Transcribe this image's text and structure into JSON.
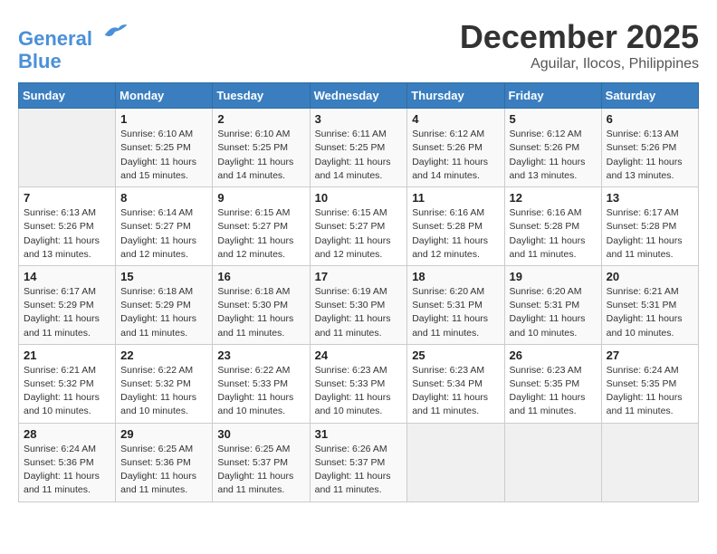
{
  "header": {
    "logo_line1": "General",
    "logo_line2": "Blue",
    "month": "December 2025",
    "location": "Aguilar, Ilocos, Philippines"
  },
  "days_of_week": [
    "Sunday",
    "Monday",
    "Tuesday",
    "Wednesday",
    "Thursday",
    "Friday",
    "Saturday"
  ],
  "weeks": [
    [
      {
        "day": "",
        "info": ""
      },
      {
        "day": "1",
        "info": "Sunrise: 6:10 AM\nSunset: 5:25 PM\nDaylight: 11 hours\nand 15 minutes."
      },
      {
        "day": "2",
        "info": "Sunrise: 6:10 AM\nSunset: 5:25 PM\nDaylight: 11 hours\nand 14 minutes."
      },
      {
        "day": "3",
        "info": "Sunrise: 6:11 AM\nSunset: 5:25 PM\nDaylight: 11 hours\nand 14 minutes."
      },
      {
        "day": "4",
        "info": "Sunrise: 6:12 AM\nSunset: 5:26 PM\nDaylight: 11 hours\nand 14 minutes."
      },
      {
        "day": "5",
        "info": "Sunrise: 6:12 AM\nSunset: 5:26 PM\nDaylight: 11 hours\nand 13 minutes."
      },
      {
        "day": "6",
        "info": "Sunrise: 6:13 AM\nSunset: 5:26 PM\nDaylight: 11 hours\nand 13 minutes."
      }
    ],
    [
      {
        "day": "7",
        "info": "Sunrise: 6:13 AM\nSunset: 5:26 PM\nDaylight: 11 hours\nand 13 minutes."
      },
      {
        "day": "8",
        "info": "Sunrise: 6:14 AM\nSunset: 5:27 PM\nDaylight: 11 hours\nand 12 minutes."
      },
      {
        "day": "9",
        "info": "Sunrise: 6:15 AM\nSunset: 5:27 PM\nDaylight: 11 hours\nand 12 minutes."
      },
      {
        "day": "10",
        "info": "Sunrise: 6:15 AM\nSunset: 5:27 PM\nDaylight: 11 hours\nand 12 minutes."
      },
      {
        "day": "11",
        "info": "Sunrise: 6:16 AM\nSunset: 5:28 PM\nDaylight: 11 hours\nand 12 minutes."
      },
      {
        "day": "12",
        "info": "Sunrise: 6:16 AM\nSunset: 5:28 PM\nDaylight: 11 hours\nand 11 minutes."
      },
      {
        "day": "13",
        "info": "Sunrise: 6:17 AM\nSunset: 5:28 PM\nDaylight: 11 hours\nand 11 minutes."
      }
    ],
    [
      {
        "day": "14",
        "info": "Sunrise: 6:17 AM\nSunset: 5:29 PM\nDaylight: 11 hours\nand 11 minutes."
      },
      {
        "day": "15",
        "info": "Sunrise: 6:18 AM\nSunset: 5:29 PM\nDaylight: 11 hours\nand 11 minutes."
      },
      {
        "day": "16",
        "info": "Sunrise: 6:18 AM\nSunset: 5:30 PM\nDaylight: 11 hours\nand 11 minutes."
      },
      {
        "day": "17",
        "info": "Sunrise: 6:19 AM\nSunset: 5:30 PM\nDaylight: 11 hours\nand 11 minutes."
      },
      {
        "day": "18",
        "info": "Sunrise: 6:20 AM\nSunset: 5:31 PM\nDaylight: 11 hours\nand 11 minutes."
      },
      {
        "day": "19",
        "info": "Sunrise: 6:20 AM\nSunset: 5:31 PM\nDaylight: 11 hours\nand 10 minutes."
      },
      {
        "day": "20",
        "info": "Sunrise: 6:21 AM\nSunset: 5:31 PM\nDaylight: 11 hours\nand 10 minutes."
      }
    ],
    [
      {
        "day": "21",
        "info": "Sunrise: 6:21 AM\nSunset: 5:32 PM\nDaylight: 11 hours\nand 10 minutes."
      },
      {
        "day": "22",
        "info": "Sunrise: 6:22 AM\nSunset: 5:32 PM\nDaylight: 11 hours\nand 10 minutes."
      },
      {
        "day": "23",
        "info": "Sunrise: 6:22 AM\nSunset: 5:33 PM\nDaylight: 11 hours\nand 10 minutes."
      },
      {
        "day": "24",
        "info": "Sunrise: 6:23 AM\nSunset: 5:33 PM\nDaylight: 11 hours\nand 10 minutes."
      },
      {
        "day": "25",
        "info": "Sunrise: 6:23 AM\nSunset: 5:34 PM\nDaylight: 11 hours\nand 11 minutes."
      },
      {
        "day": "26",
        "info": "Sunrise: 6:23 AM\nSunset: 5:35 PM\nDaylight: 11 hours\nand 11 minutes."
      },
      {
        "day": "27",
        "info": "Sunrise: 6:24 AM\nSunset: 5:35 PM\nDaylight: 11 hours\nand 11 minutes."
      }
    ],
    [
      {
        "day": "28",
        "info": "Sunrise: 6:24 AM\nSunset: 5:36 PM\nDaylight: 11 hours\nand 11 minutes."
      },
      {
        "day": "29",
        "info": "Sunrise: 6:25 AM\nSunset: 5:36 PM\nDaylight: 11 hours\nand 11 minutes."
      },
      {
        "day": "30",
        "info": "Sunrise: 6:25 AM\nSunset: 5:37 PM\nDaylight: 11 hours\nand 11 minutes."
      },
      {
        "day": "31",
        "info": "Sunrise: 6:26 AM\nSunset: 5:37 PM\nDaylight: 11 hours\nand 11 minutes."
      },
      {
        "day": "",
        "info": ""
      },
      {
        "day": "",
        "info": ""
      },
      {
        "day": "",
        "info": ""
      }
    ]
  ]
}
